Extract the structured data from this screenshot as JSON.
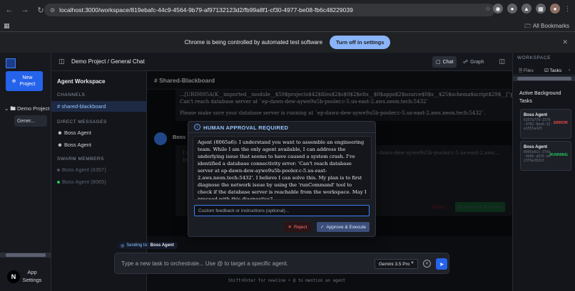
{
  "browser": {
    "url": "localhost:3000/workspace/819ebafc-44c9-4564-9b79-af97132123d2/fb99a8f1-cf30-4977-be08-fb6c48229039",
    "all_bookmarks": "All Bookmarks",
    "infobar_text": "Chrome is being controlled by automated test software",
    "infobar_button": "Turn off in settings"
  },
  "left_rail": {
    "new_project": "New Project",
    "project": "Demo Project",
    "sub_item": "Gener...",
    "avatar_letter": "N",
    "app_settings": "App Settings"
  },
  "topbar": {
    "breadcrumb": "Demo Project / General Chat",
    "tab_chat": "Chat",
    "tab_graph": "Graph"
  },
  "channels": {
    "title": "Agent Workspace",
    "channels_label": "CHANNELS",
    "active_channel": "shared-blackboard",
    "dm_label": "DIRECT MESSAGES",
    "dm_items": [
      "Boss Agent",
      "Boss Agent"
    ],
    "swarm_label": "SWARM MEMBERS",
    "swarm_items": [
      "Boss Agent (6357)",
      "Boss Agent (8065)"
    ]
  },
  "chat": {
    "header": "Shared-Blackboard",
    "prev_line1": "...[URI0895A(K__imported__module__$59$projects$42$files$2$s$0$2$elts__$0$apps$2$source$0$s__$25$schema$script$29$__[\"prisma\"].channel]",
    "prev_line2": "Can't reach database server at `ep-dawn-dew-aywe9u5b-pooler.c-5.us-east-2.aws.neon.tech:5432`",
    "prev_line3": "Please make sure your database server is running at `ep-dawn-dew-aywe9u5b-pooler.c-5.us-east-2.aws.neon.tech:5432`.",
    "boss_name": "Boss",
    "bg_text": "I und... can address the underlying issue that seems to have caus... ver at ep-dawn-dew-aywe9u5b-pooler.c-5.us-east-2.aws... by using the 'runCommand' tool to check if the",
    "bg_reject": "Reject",
    "bg_approve": "Approve & Execute"
  },
  "modal": {
    "title": "HUMAN APPROVAL REQUIRED",
    "message": "Agent (8065a6): I understand you want to assemble an engineering team. While I am the only agent available, I can address the underlying issue that seems to have caused a system crash. I've identified a database connectivity error: 'Can't reach database server at ep-dawn-dew-aywe9u5b-pooler.c-5.us-east-2.aws.neon.tech:5432'. I believe I can solve this. My plan is to first diagnose the network issue by using the 'runCommand' tool to check if the database server is reachable from the workspace. May I proceed with this diagnostics?",
    "feedback_placeholder": "Custom feedback or instructions (optional)...",
    "reject": "Reject",
    "approve": "Approve & Execute"
  },
  "composer": {
    "sending_to_label": "Sending to:",
    "sending_to_value": "Boss Agent",
    "placeholder": "Type a new task to orchestrate... Use @ to target a specific agent.",
    "model": "Gemini 3.5 Pro",
    "hint": "Shift+Enter for newline • @ to mention an agent"
  },
  "right_panel": {
    "label": "WORKSPACE",
    "tab_files": "Files",
    "tab_tasks": "Tasks",
    "title": "Active Background Tasks",
    "tasks": [
      {
        "name": "Boss Agent",
        "id": "6357a77d-1576-4782-8ea0-32e1555a425",
        "status": "ERROR"
      },
      {
        "name": "Boss Agent",
        "id": "8065a61c-37da-4b0b-a635-be2379a382b3",
        "status": "RUNNING"
      }
    ]
  },
  "colors": {
    "accent": "#2563eb",
    "error": "#ef4444",
    "running": "#22c55e"
  }
}
